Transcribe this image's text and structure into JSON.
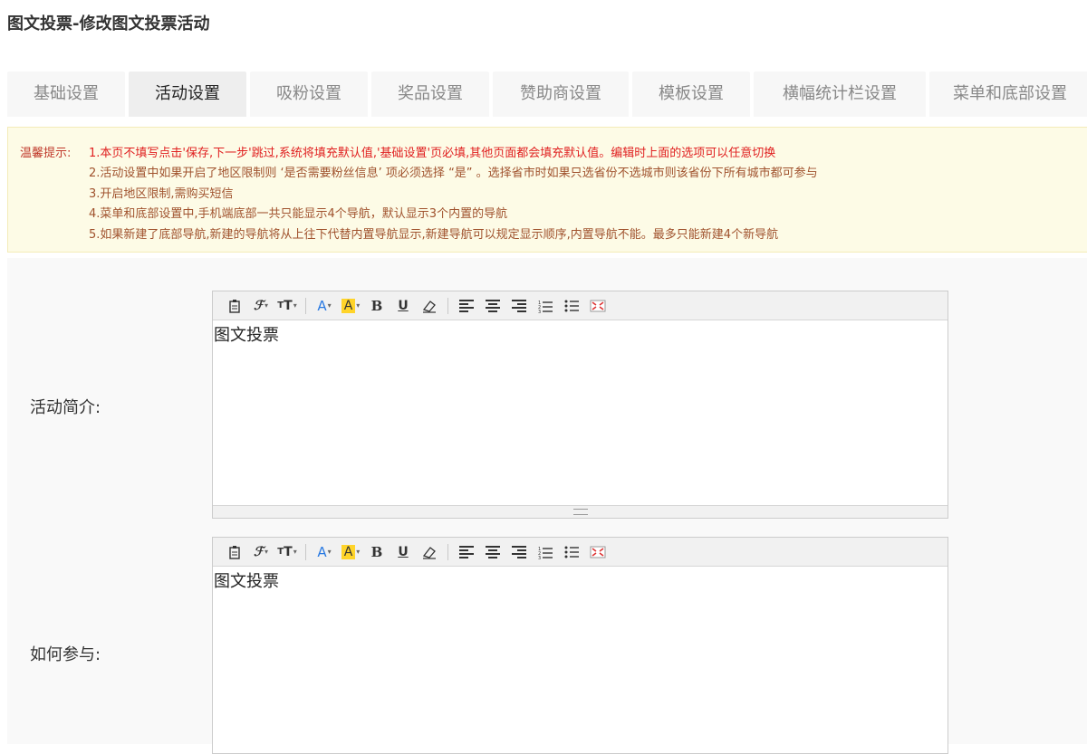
{
  "page": {
    "title": "图文投票-修改图文投票活动"
  },
  "tabs": [
    {
      "label": "基础设置",
      "active": false
    },
    {
      "label": "活动设置",
      "active": true
    },
    {
      "label": "吸粉设置",
      "active": false
    },
    {
      "label": "奖品设置",
      "active": false
    },
    {
      "label": "赞助商设置",
      "active": false
    },
    {
      "label": "模板设置",
      "active": false
    },
    {
      "label": "横幅统计栏设置",
      "active": false
    },
    {
      "label": "菜单和底部设置",
      "active": false
    }
  ],
  "notice": {
    "label": "温馨提示:",
    "lines": [
      "1.本页不填写点击'保存,下一步'跳过,系统将填充默认值,'基础设置'页必填,其他页面都会填充默认值。编辑时上面的选项可以任意切换",
      "2.活动设置中如果开启了地区限制则 ‘是否需要粉丝信息’ 项必须选择 “是” 。选择省市时如果只选省份不选城市则该省份下所有城市都可参与",
      "3.开启地区限制,需购买短信",
      "4.菜单和底部设置中,手机端底部一共只能显示4个导航，默认显示3个内置的导航",
      "5.如果新建了底部导航,新建的导航将从上往下代替内置导航显示,新建导航可以规定显示顺序,内置导航不能。最多只能新建4个新导航"
    ]
  },
  "fields": [
    {
      "label": "活动简介:",
      "content": "图文投票"
    },
    {
      "label": "如何参与:",
      "content": "图文投票"
    }
  ],
  "toolbar_icons": [
    "paste-icon",
    "font-family-icon",
    "font-size-icon",
    "font-color-icon",
    "highlight-color-icon",
    "bold-icon",
    "underline-icon",
    "eraser-icon",
    "align-left-icon",
    "align-center-icon",
    "align-right-icon",
    "ordered-list-icon",
    "unordered-list-icon",
    "fullscreen-icon"
  ],
  "colors": {
    "accent": "#2a7ae2",
    "highlight": "#ffd42a",
    "notice_bg": "#fdfbe6",
    "notice_text": "#e02020"
  }
}
